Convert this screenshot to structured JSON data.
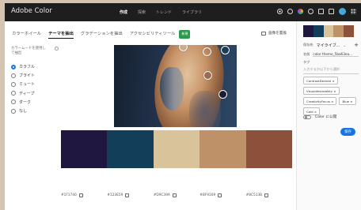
{
  "app": {
    "title": "Adobe Color"
  },
  "topnav": [
    "作成",
    "探索",
    "トレンド",
    "ライブラリ"
  ],
  "tabs": [
    "カラーホイール",
    "テーマを抽出",
    "グラデーションを抽出",
    "アクセシビリティツール"
  ],
  "badge": "新規",
  "save_image": "画像を置換",
  "mode_label": "カラームードを使用して抽出",
  "moods": [
    "カラフル",
    "ブライト",
    "ミュート",
    "ディープ",
    "ダーク",
    "なし"
  ],
  "selected_mood": "カラフル",
  "swatches": [
    {
      "color": "#1F1740",
      "hex": "#1F1740"
    },
    {
      "color": "#123E59",
      "hex": "#123E59"
    },
    {
      "color": "#D9C39A",
      "hex": "#D9C39A"
    },
    {
      "color": "#BF9169",
      "hex": "#BF9169"
    },
    {
      "color": "#8C513B",
      "hex": "#8C513B"
    }
  ],
  "right_panel": {
    "library_label": "保存先",
    "library_value": "マイライブ...",
    "name_label": "名前",
    "name_value": "color theme_5ba63ea...",
    "tags_label": "タグ",
    "tags_placeholder": "入力するか以下から選択",
    "chips": [
      "ContrastDecked ×",
      "Visualdesirability ×",
      "CreativityFocus ×",
      "Blue ×",
      "Cold ×"
    ],
    "publish_label": "Color に公開",
    "save_button": "保存"
  }
}
